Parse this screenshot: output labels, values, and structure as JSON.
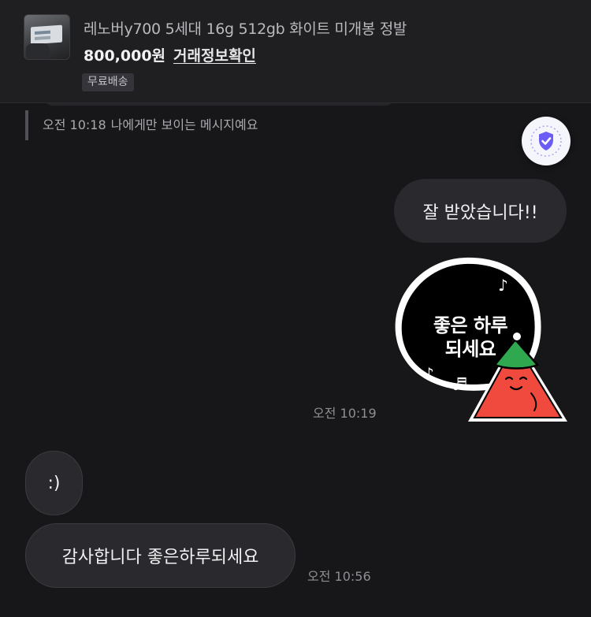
{
  "product": {
    "title": "레노버y700 5세대 16g 512gb 화이트 미개봉 정발",
    "price": "800,000원",
    "trade_info_link": "거래정보확인",
    "shipping_badge": "무료배송"
  },
  "private_note": {
    "time": "오전 10:18",
    "text": "나에게만 보이는 메시지예요"
  },
  "messages": {
    "sent_text": "잘 받았습니다!!",
    "sticker_line_1": "좋은 하루",
    "sticker_line_2": "되세요",
    "sent_time": "오전 10:19",
    "received_1": ":)",
    "received_2": "감사합니다 좋은하루되세요",
    "received_time": "오전 10:56"
  },
  "colors": {
    "background": "#17171a",
    "bubble": "#2a2a2e",
    "shield_accent": "#6a5cf5",
    "sticker_hat": "#2fa84f",
    "sticker_body": "#f04a3e"
  },
  "icons": {
    "shield": "shield-check-icon"
  }
}
